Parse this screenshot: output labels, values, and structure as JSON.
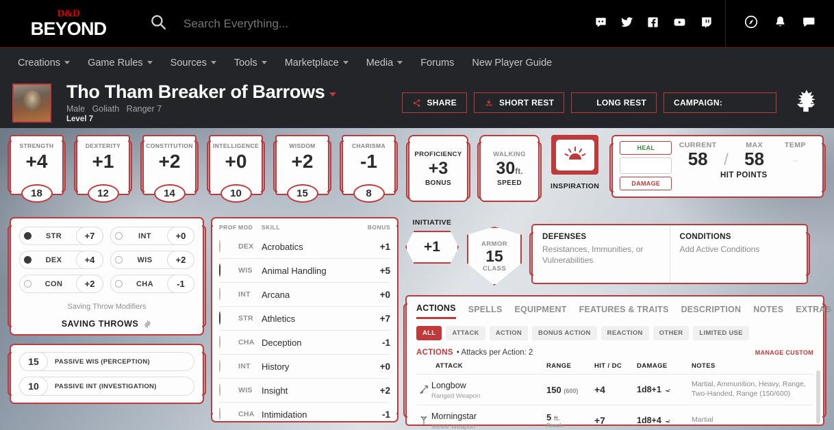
{
  "topbar": {
    "logo_top": "D&D",
    "logo_bottom": "BEYOND",
    "search_placeholder": "Search Everything...",
    "social": [
      "discord-icon",
      "twitter-icon",
      "facebook-icon",
      "youtube-icon",
      "twitch-icon"
    ],
    "util": [
      "compass-icon",
      "bell-icon",
      "chat-icon"
    ]
  },
  "nav": {
    "items": [
      {
        "label": "Creations",
        "caret": true
      },
      {
        "label": "Game Rules",
        "caret": true
      },
      {
        "label": "Sources",
        "caret": true
      },
      {
        "label": "Tools",
        "caret": true
      },
      {
        "label": "Marketplace",
        "caret": true
      },
      {
        "label": "Media",
        "caret": true
      },
      {
        "label": "Forums",
        "caret": false
      },
      {
        "label": "New Player Guide",
        "caret": false
      }
    ]
  },
  "character": {
    "name": "Tho Tham Breaker of Barrows",
    "gender": "Male",
    "race": "Goliath",
    "class_level": "Ranger 7",
    "level": "Level 7",
    "buttons": {
      "share": "SHARE",
      "short_rest": "SHORT REST",
      "long_rest": "LONG REST",
      "campaign": "CAMPAIGN:"
    }
  },
  "abilities": [
    {
      "name": "STRENGTH",
      "mod": "+4",
      "score": "18"
    },
    {
      "name": "DEXTERITY",
      "mod": "+1",
      "score": "12"
    },
    {
      "name": "CONSTITUTION",
      "mod": "+2",
      "score": "14"
    },
    {
      "name": "INTELLIGENCE",
      "mod": "+0",
      "score": "10"
    },
    {
      "name": "WISDOM",
      "mod": "+2",
      "score": "15"
    },
    {
      "name": "CHARISMA",
      "mod": "-1",
      "score": "8"
    }
  ],
  "proficiency": {
    "top": "PROFICIENCY",
    "value": "+3",
    "bottom": "BONUS"
  },
  "speed": {
    "top": "WALKING",
    "value": "30",
    "unit": "ft.",
    "bottom": "SPEED"
  },
  "inspiration": {
    "label": "INSPIRATION",
    "icon": "inspiration-sun-icon"
  },
  "hit_points": {
    "heal_label": "HEAL",
    "damage_label": "DAMAGE",
    "current_label": "CURRENT",
    "max_label": "MAX",
    "temp_label": "TEMP",
    "current": "58",
    "max": "58",
    "temp": "--",
    "footer": "HIT POINTS"
  },
  "saving_throws": {
    "items": [
      {
        "name": "STR",
        "value": "+7",
        "proficient": true
      },
      {
        "name": "INT",
        "value": "+0",
        "proficient": false
      },
      {
        "name": "DEX",
        "value": "+4",
        "proficient": true
      },
      {
        "name": "WIS",
        "value": "+2",
        "proficient": false
      },
      {
        "name": "CON",
        "value": "+2",
        "proficient": false
      },
      {
        "name": "CHA",
        "value": "-1",
        "proficient": false
      }
    ],
    "subtitle": "Saving Throw Modifiers",
    "footer": "SAVING THROWS"
  },
  "passives": [
    {
      "value": "15",
      "label": "PASSIVE WIS (PERCEPTION)"
    },
    {
      "value": "10",
      "label": "PASSIVE INT (INVESTIGATION)"
    }
  ],
  "skills": {
    "headers": {
      "prof": "PROF",
      "mod": "MOD",
      "skill": "SKILL",
      "bonus": "BONUS"
    },
    "rows": [
      {
        "mod": "DEX",
        "name": "Acrobatics",
        "bonus": "+1",
        "proficient": false
      },
      {
        "mod": "WIS",
        "name": "Animal Handling",
        "bonus": "+5",
        "proficient": true
      },
      {
        "mod": "INT",
        "name": "Arcana",
        "bonus": "+0",
        "proficient": false
      },
      {
        "mod": "STR",
        "name": "Athletics",
        "bonus": "+7",
        "proficient": true
      },
      {
        "mod": "CHA",
        "name": "Deception",
        "bonus": "-1",
        "proficient": false
      },
      {
        "mod": "INT",
        "name": "History",
        "bonus": "+0",
        "proficient": false
      },
      {
        "mod": "WIS",
        "name": "Insight",
        "bonus": "+2",
        "proficient": false
      },
      {
        "mod": "CHA",
        "name": "Intimidation",
        "bonus": "-1",
        "proficient": false
      }
    ]
  },
  "initiative": {
    "label": "INITIATIVE",
    "value": "+1"
  },
  "armor_class": {
    "top": "ARMOR",
    "value": "15",
    "bottom": "CLASS"
  },
  "defenses": {
    "title": "DEFENSES",
    "subtitle": "Resistances, Immunities, or Vulnerabilities"
  },
  "conditions": {
    "title": "CONDITIONS",
    "subtitle": "Add Active Conditions"
  },
  "tabs": [
    {
      "label": "ACTIONS",
      "active": true
    },
    {
      "label": "SPELLS",
      "active": false
    },
    {
      "label": "EQUIPMENT",
      "active": false
    },
    {
      "label": "FEATURES & TRAITS",
      "active": false
    },
    {
      "label": "DESCRIPTION",
      "active": false
    },
    {
      "label": "NOTES",
      "active": false
    },
    {
      "label": "EXTRAS",
      "active": false
    }
  ],
  "filters": [
    {
      "label": "ALL",
      "active": true
    },
    {
      "label": "ATTACK",
      "active": false
    },
    {
      "label": "ACTION",
      "active": false
    },
    {
      "label": "BONUS ACTION",
      "active": false
    },
    {
      "label": "REACTION",
      "active": false
    },
    {
      "label": "OTHER",
      "active": false
    },
    {
      "label": "LIMITED USE",
      "active": false
    }
  ],
  "actions": {
    "section_label": "ACTIONS",
    "attacks_per_action": "• Attacks per Action: 2",
    "manage_label": "MANAGE CUSTOM",
    "headers": {
      "attack": "ATTACK",
      "range": "RANGE",
      "hit": "HIT / DC",
      "damage": "DAMAGE",
      "notes": "NOTES"
    },
    "rows": [
      {
        "name": "Longbow",
        "type": "Ranged Weapon",
        "range": "150",
        "range_sub": "(600)",
        "range_unit": "",
        "hit": "+4",
        "damage": "1d8+1",
        "notes": "Martial, Ammunition, Heavy, Range, Two-Handed, Range (150/600)"
      },
      {
        "name": "Morningstar",
        "type": "Melee Weapon",
        "range": "5",
        "range_sub": "Reach",
        "range_unit": "ft.",
        "hit": "+7",
        "damage": "1d8+4",
        "notes": "Martial"
      }
    ]
  }
}
